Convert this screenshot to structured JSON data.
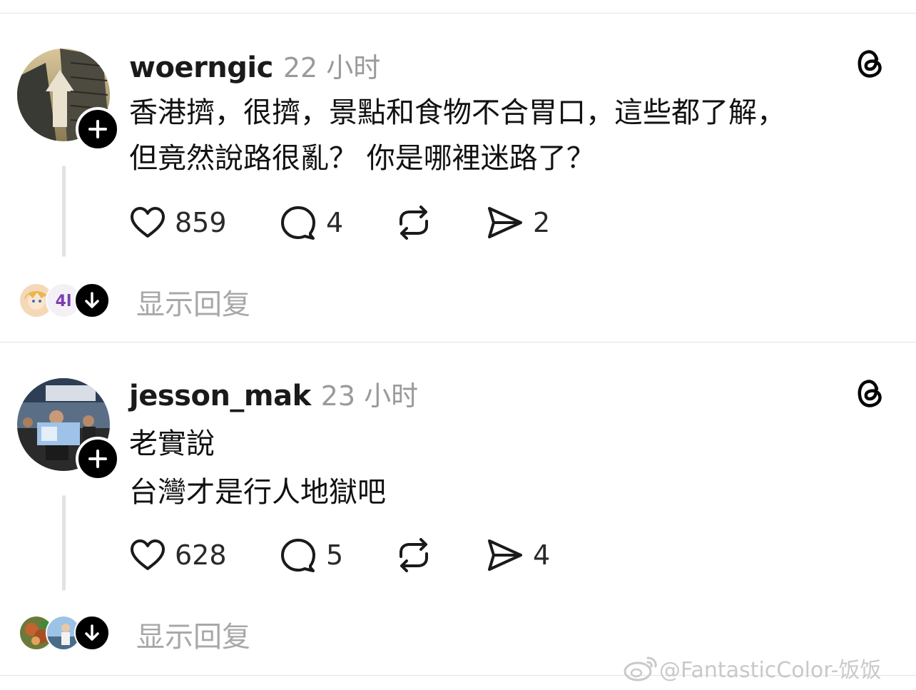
{
  "posts": [
    {
      "username": "woerngic",
      "time": "22 小时",
      "lines": [
        "香港擠，很擠，景點和食物不合胃口，這些都了解，",
        "但竟然說路很亂？ 你是哪裡迷路了？"
      ],
      "likes": "859",
      "comments": "4",
      "shares": "2",
      "show_replies": "显示回复",
      "icons": {
        "like": "heart-icon",
        "comment": "comment-icon",
        "repost": "repost-icon",
        "share": "send-icon",
        "brand": "threads-logo-icon"
      }
    },
    {
      "username": "jesson_mak",
      "time": "23 小时",
      "lines": [
        "老實說",
        "台灣才是行人地獄吧"
      ],
      "likes": "628",
      "comments": "5",
      "shares": "4",
      "show_replies": "显示回复",
      "icons": {
        "like": "heart-icon",
        "comment": "comment-icon",
        "repost": "repost-icon",
        "share": "send-icon",
        "brand": "threads-logo-icon"
      }
    }
  ],
  "watermark": "@FantasticColor-饭饭",
  "colors": {
    "text": "#111111",
    "muted": "#9a9a9a",
    "divider": "#e3e3e3",
    "thread_line": "#e2e2e2"
  }
}
